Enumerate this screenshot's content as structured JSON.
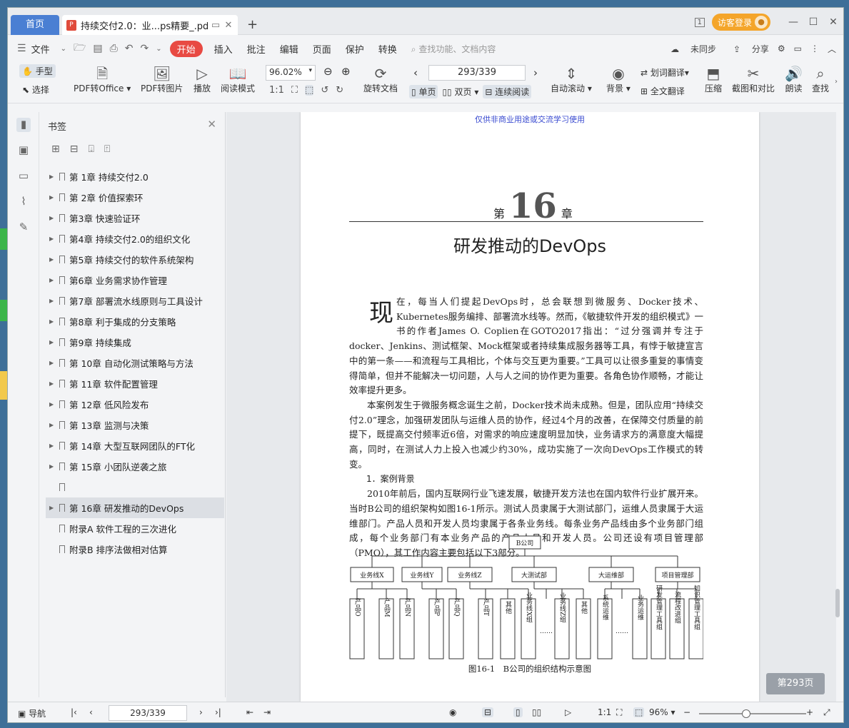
{
  "titlebar": {
    "home_tab": "首页",
    "doc_tab": "持续交付2.0：业...ps精要_.pdf",
    "pdf_badge": "P",
    "new_tab": "+",
    "login": "访客登录",
    "window_count": "1"
  },
  "menubar": {
    "file": "文件",
    "start": "开始",
    "items": [
      "插入",
      "批注",
      "编辑",
      "页面",
      "保护",
      "转换"
    ],
    "search_placeholder": "查找功能、文档内容",
    "sync": "未同步",
    "share": "分享"
  },
  "toolbar": {
    "hand": "手型",
    "select": "选择",
    "pdf_to_office": "PDF转Office",
    "pdf_to_image": "PDF转图片",
    "play": "播放",
    "read_mode": "阅读模式",
    "zoom": "96.02%",
    "rotate_doc": "旋转文档",
    "page_display": "293/339",
    "single_page": "单页",
    "double_page": "双页",
    "continuous": "连续阅读",
    "auto_scroll": "自动滚动",
    "background": "背景",
    "word_translate": "划词翻译",
    "full_translate": "全文翻译",
    "compress": "压缩",
    "crop_compare": "截图和对比",
    "read_aloud": "朗读",
    "find": "查找"
  },
  "bookmarks": {
    "title": "书签",
    "items": [
      {
        "label": "第 1章 持续交付2.0",
        "has_children": true
      },
      {
        "label": "第 2章 价值探索环",
        "has_children": true
      },
      {
        "label": "第3章 快速验证环",
        "has_children": true
      },
      {
        "label": "第4章 持续交付2.0的组织文化",
        "has_children": true
      },
      {
        "label": "第5章 持续交付的软件系统架构",
        "has_children": true
      },
      {
        "label": "第6章 业务需求协作管理",
        "has_children": true
      },
      {
        "label": "第7章 部署流水线原则与工具设计",
        "has_children": true
      },
      {
        "label": "第8章 利于集成的分支策略",
        "has_children": true
      },
      {
        "label": "第9章 持续集成",
        "has_children": true
      },
      {
        "label": "第 10章 自动化测试策略与方法",
        "has_children": true
      },
      {
        "label": "第 11章 软件配置管理",
        "has_children": true
      },
      {
        "label": "第 12章 低风险发布",
        "has_children": true
      },
      {
        "label": "第 13章 监测与决策",
        "has_children": true
      },
      {
        "label": "第 14章 大型互联网团队的FT化",
        "has_children": true
      },
      {
        "label": "第 15章 小团队逆袭之旅",
        "has_children": true
      },
      {
        "label": "",
        "has_children": false
      },
      {
        "label": "第 16章 研发推动的DevOps",
        "has_children": true,
        "active": true
      },
      {
        "label": "附录A 软件工程的三次进化",
        "has_children": false
      },
      {
        "label": "附录B 排序法做相对估算",
        "has_children": false
      }
    ]
  },
  "page": {
    "watermark": "仅供非商业用途或交流学习使用",
    "chapter_prefix": "第",
    "chapter_number": "16",
    "chapter_suffix": "章",
    "chapter_title": "研发推动的DevOps",
    "dropcap": "现",
    "para1": "在，每当人们提起DevOps时，总会联想到微服务、Docker技术、Kubernetes服务编排、部署流水线等。然而，《敏捷软件开发的组织模式》一书的作者James O. Coplien在GOTO2017指出：“过分强调并专注于docker、Jenkins、测试框架、Mock框架或者持续集成服务器等工具，有悖于敏捷宣言中的第一条——和流程与工具相比，个体与交互更为重要。”工具可以让很多重复的事情变得简单，但并不能解决一切问题，人与人之间的协作更为重要。各角色协作顺畅，才能让效率提升更多。",
    "para2": "本案例发生于微服务概念诞生之前，Docker技术尚未成熟。但是，团队应用“持续交付2.0”理念，加强研发团队与运维人员的协作，经过4个月的改善，在保障交付质量的前提下，既提高交付频率近6倍，对需求的响应速度明显加快，业务请求方的满意度大幅提高，同时，在测试人力上投入也减少约30%，成功实施了一次向DevOps工作模式的转变。",
    "section1": "1．案例背景",
    "para3": "2010年前后，国内互联网行业飞速发展，敏捷开发方法也在国内软件行业扩展开来。当时B公司的组织架构如图16-1所示。测试人员隶属于大测试部门，运维人员隶属于大运维部门。产品人员和开发人员均隶属于各条业务线。每条业务产品线由多个业务部门组成，每个业务部门有本业务产品的产品人员和开发人员。公司还设有项目管理部（PMO），其工作内容主要包括以下3部分。",
    "figure_caption": "图16-1　B公司的组织结构示意图",
    "org": {
      "root": "B公司",
      "level2": [
        "业务线X",
        "业务线Y",
        "业务线Z",
        "大测试部",
        "大运维部",
        "项目管理部"
      ],
      "level3": [
        "产品O",
        "产品M",
        "产品N",
        "产品P",
        "产品Q",
        "产品T",
        "其他",
        "业务线X组",
        "……",
        "业务线Z组",
        "其他",
        "系统运维",
        "……",
        "业务运维",
        "研发管理工具组",
        "流程改进组",
        "知识管理工具组"
      ]
    }
  },
  "page_indicator": "第293页",
  "statusbar": {
    "nav": "导航",
    "page": "293/339",
    "zoom": "96%"
  }
}
